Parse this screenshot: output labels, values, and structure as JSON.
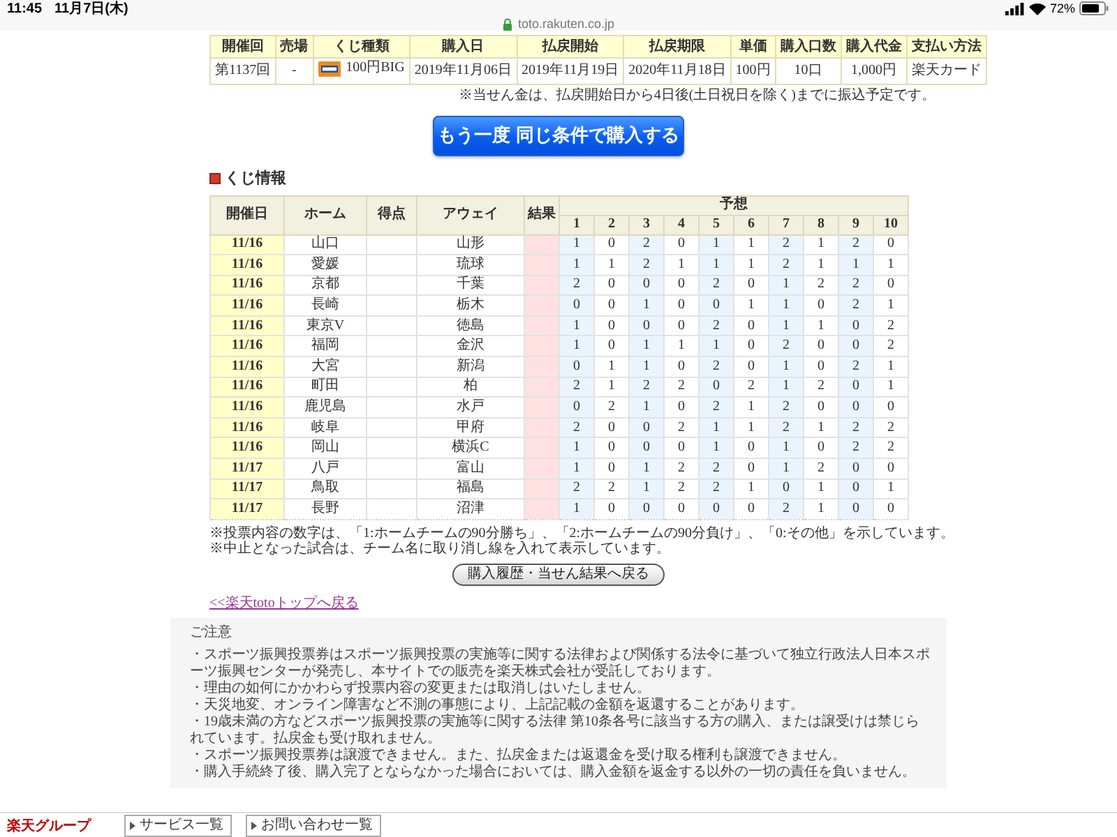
{
  "status_bar": {
    "time": "11:45",
    "date": "11月7日(木)",
    "battery": "72%"
  },
  "address_bar": {
    "url": "toto.rakuten.co.jp"
  },
  "purchase_table": {
    "columns": [
      "開催回",
      "売場",
      "くじ種類",
      "購入日",
      "払戻開始",
      "払戻期限",
      "単価",
      "購入口数",
      "購入代金",
      "支払い方法"
    ],
    "rows": [
      {
        "round": "第1137回",
        "counter": "-",
        "lottery_type": "100円BIG",
        "purchase_date": "2019年11月06日",
        "refund_start": "2019年11月19日",
        "refund_deadline": "2020年11月18日",
        "unit_price": "100円",
        "units": "10口",
        "amount": "1,000円",
        "payment": "楽天カード"
      }
    ]
  },
  "payout_note": "※当せん金は、払戻開始日から4日後(土日祝日を除く)までに振込予定です。",
  "repurchase_button": "もう一度 同じ条件で購入する",
  "section_title": "くじ情報",
  "match_table": {
    "columns": {
      "date": "開催日",
      "home": "ホーム",
      "score": "得点",
      "away": "アウェイ",
      "result": "結果",
      "prediction": "予想"
    },
    "prediction_numbers": [
      "1",
      "2",
      "3",
      "4",
      "5",
      "6",
      "7",
      "8",
      "9",
      "10"
    ],
    "rows": [
      {
        "date": "11/16",
        "home": "山口",
        "away": "山形",
        "picks": [
          "1",
          "0",
          "2",
          "0",
          "1",
          "1",
          "2",
          "1",
          "2",
          "0"
        ]
      },
      {
        "date": "11/16",
        "home": "愛媛",
        "away": "琉球",
        "picks": [
          "1",
          "1",
          "2",
          "1",
          "1",
          "1",
          "2",
          "1",
          "1",
          "1"
        ]
      },
      {
        "date": "11/16",
        "home": "京都",
        "away": "千葉",
        "picks": [
          "2",
          "0",
          "0",
          "0",
          "2",
          "0",
          "1",
          "2",
          "2",
          "0"
        ]
      },
      {
        "date": "11/16",
        "home": "長崎",
        "away": "栃木",
        "picks": [
          "0",
          "0",
          "1",
          "0",
          "0",
          "1",
          "1",
          "0",
          "2",
          "1"
        ]
      },
      {
        "date": "11/16",
        "home": "東京V",
        "away": "徳島",
        "picks": [
          "1",
          "0",
          "0",
          "0",
          "2",
          "0",
          "1",
          "1",
          "0",
          "2"
        ]
      },
      {
        "date": "11/16",
        "home": "福岡",
        "away": "金沢",
        "picks": [
          "1",
          "0",
          "1",
          "1",
          "1",
          "0",
          "2",
          "0",
          "0",
          "2"
        ]
      },
      {
        "date": "11/16",
        "home": "大宮",
        "away": "新潟",
        "picks": [
          "0",
          "1",
          "1",
          "0",
          "2",
          "0",
          "1",
          "0",
          "2",
          "1"
        ]
      },
      {
        "date": "11/16",
        "home": "町田",
        "away": "柏",
        "picks": [
          "2",
          "1",
          "2",
          "2",
          "0",
          "2",
          "1",
          "2",
          "0",
          "1"
        ]
      },
      {
        "date": "11/16",
        "home": "鹿児島",
        "away": "水戸",
        "picks": [
          "0",
          "2",
          "1",
          "0",
          "2",
          "1",
          "2",
          "0",
          "0",
          "0"
        ]
      },
      {
        "date": "11/16",
        "home": "岐阜",
        "away": "甲府",
        "picks": [
          "2",
          "0",
          "0",
          "2",
          "1",
          "1",
          "2",
          "1",
          "2",
          "2"
        ]
      },
      {
        "date": "11/16",
        "home": "岡山",
        "away": "横浜C",
        "picks": [
          "1",
          "0",
          "0",
          "0",
          "1",
          "0",
          "1",
          "0",
          "2",
          "2"
        ]
      },
      {
        "date": "11/17",
        "home": "八戸",
        "away": "富山",
        "picks": [
          "1",
          "0",
          "1",
          "2",
          "2",
          "0",
          "1",
          "2",
          "0",
          "0"
        ]
      },
      {
        "date": "11/17",
        "home": "鳥取",
        "away": "福島",
        "picks": [
          "2",
          "2",
          "1",
          "2",
          "2",
          "1",
          "0",
          "1",
          "0",
          "1"
        ]
      },
      {
        "date": "11/17",
        "home": "長野",
        "away": "沼津",
        "picks": [
          "1",
          "0",
          "0",
          "0",
          "0",
          "0",
          "2",
          "1",
          "0",
          "0"
        ]
      }
    ]
  },
  "notes": [
    "※投票内容の数字は、「1:ホームチームの90分勝ち」、「2:ホームチームの90分負け」、「0:その他」を示しています。",
    "※中止となった試合は、チーム名に取り消し線を入れて表示しています。"
  ],
  "back_button": "購入履歴・当せん結果へ戻る",
  "top_link": "<<楽天totoトップへ戻る",
  "caution": {
    "title": "ご注意",
    "items": [
      "・スポーツ振興投票券はスポーツ振興投票の実施等に関する法律および関係する法令に基づいて独立行政法人日本スポーツ振興センターが発売し、本サイトでの販売を楽天株式会社が受託しております。",
      "・理由の如何にかかわらず投票内容の変更または取消しはいたしません。",
      "・天災地変、オンライン障害など不測の事態により、上記記載の金額を返還することがあります。",
      "・19歳未満の方などスポーツ振興投票の実施等に関する法律 第10条各号に該当する方の購入、または譲受けは禁じられています。払戻金も受け取れません。",
      "・スポーツ振興投票券は譲渡できません。また、払戻金または返還金を受け取る権利も譲渡できません。",
      "・購入手続終了後、購入完了とならなかった場合においては、購入金額を返金する以外の一切の責任を負いません。"
    ]
  },
  "footer": {
    "group_label": "楽天グループ",
    "links": [
      "サービス一覧",
      "お問い合わせ一覧"
    ]
  }
}
